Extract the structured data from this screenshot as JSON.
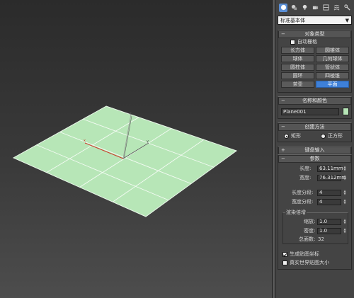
{
  "panel": {
    "object_type_dropdown": "标准基本体",
    "rollouts": {
      "object_type": {
        "title": "对象类型",
        "auto_grid": "自动栅格",
        "buttons": [
          "长方体",
          "圆锥体",
          "球体",
          "几何球体",
          "圆柱体",
          "管状体",
          "圆环",
          "四棱锥",
          "茶壶",
          "平面"
        ],
        "active_button": "平面"
      },
      "name_color": {
        "title": "名称和颜色",
        "name_value": "Plane001",
        "color": "#b7e6b7"
      },
      "creation_method": {
        "title": "创建方法",
        "options": [
          "矩形",
          "正方形"
        ],
        "selected": "矩形"
      },
      "keyboard_entry": {
        "title": "键盘输入"
      },
      "parameters": {
        "title": "参数",
        "length_label": "长度:",
        "length_value": "63.11mm",
        "width_label": "宽度:",
        "width_value": "76.312mm",
        "length_segs_label": "长度分段:",
        "length_segs_value": "4",
        "width_segs_label": "宽度分段:",
        "width_segs_value": "4",
        "render_multipliers": {
          "title": "渲染倍增",
          "scale_label": "缩放:",
          "scale_value": "1.0",
          "density_label": "密度:",
          "density_value": "1.0",
          "total_faces_label": "总面数:",
          "total_faces_value": "32"
        },
        "gen_mapping": "生成贴图坐标",
        "real_world": "真实世界贴图大小"
      }
    }
  },
  "colors": {
    "plane_fill": "#b7e6b7",
    "accent_blue": "#3e80d8"
  }
}
